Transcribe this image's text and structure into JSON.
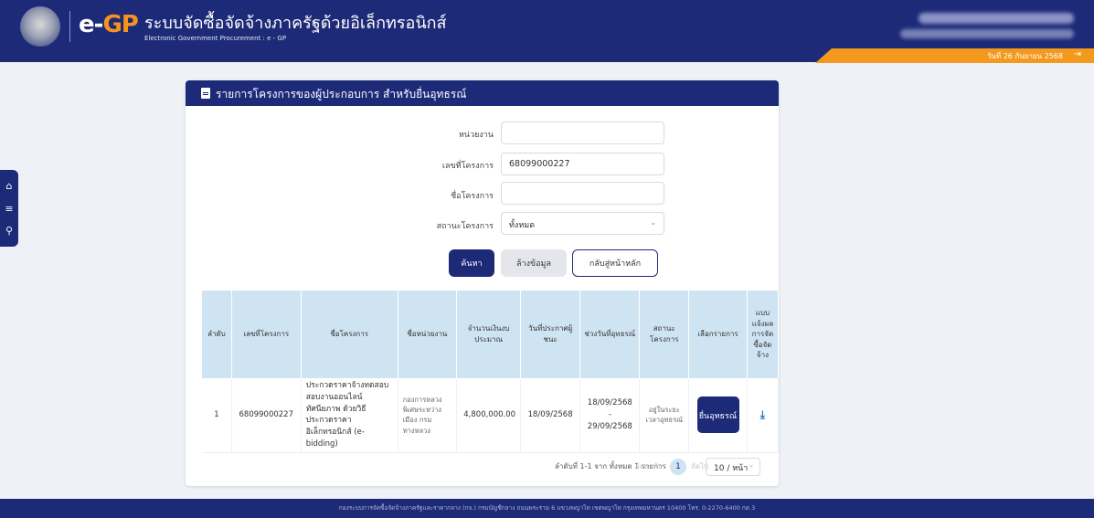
{
  "header": {
    "logo_e": "e-",
    "logo_gp": "GP",
    "title_th": "ระบบจัดซื้อจัดจ้างภาครัฐด้วยอิเล็กทรอนิกส์",
    "title_en": "Electronic Government Procurement : e - GP",
    "date_text": "วันที่ 26 กันยายน 2568"
  },
  "sidenav": {
    "icons": [
      "home-icon",
      "menu-icon",
      "search-icon"
    ]
  },
  "card": {
    "title": "รายการโครงการของผู้ประกอบการ สำหรับยื่นอุทธรณ์"
  },
  "form": {
    "agency_label": "หน่วยงาน",
    "agency_value": "",
    "project_no_label": "เลขที่โครงการ",
    "project_no_value": "68099000227",
    "project_name_label": "ชื่อโครงการ",
    "project_name_value": "",
    "status_label": "สถานะโครงการ",
    "status_value": "ทั้งหมด"
  },
  "buttons": {
    "search": "ค้นหา",
    "clear": "ล้างข้อมูล",
    "home": "กลับสู่หน้าหลัก"
  },
  "table": {
    "headers": {
      "no": "ลำดับ",
      "project_no": "เลขที่โครงการ",
      "project_name": "ชื่อโครงการ",
      "agency": "ชื่อหน่วยงาน",
      "budget": "จำนวนเงินงบประมาณ",
      "announce_date": "วันที่ประกาศผู้ชนะ",
      "appeal_period": "ช่วงวันที่อุทธรณ์",
      "status": "สถานะโครงการ",
      "select": "เลือกรายการ",
      "form": "แบบแจ้งผลการจัดซื้อจัดจ้าง"
    },
    "rows": [
      {
        "no": "1",
        "project_no": "68099000227",
        "project_name": "ประกวดราคาจ้างทดสอบสอบงานออนไลน์ ทัศนียภาพ ด้วยวิธีประกวดราคาอิเล็กทรอนิกส์ (e-bidding)",
        "agency": "กองการหลวงพิเศษระหว่างเมือง กรมทางหลวง",
        "budget": "4,800,000.00",
        "announce_date": "18/09/2568",
        "appeal_from": "18/09/2568",
        "appeal_sep": "-",
        "appeal_to": "29/09/2568",
        "status": "อยู่ในระยะเวลาอุทธรณ์",
        "action_label": "ยื่นอุทธรณ์",
        "download_icon": "download-icon"
      }
    ]
  },
  "pagination": {
    "summary": "ลำดับที่ 1-1 จาก ทั้งหมด 1 รายการ",
    "prev": "ย้อนกลับ",
    "current": "1",
    "next": "ถัดไป",
    "page_size": "10 / หน้า"
  },
  "footer": {
    "text": "กองระบบการจัดซื้อจัดจ้างภาครัฐและราคากลาง (กจ.) กรมบัญชีกลาง ถนนพระราม 6 แขวงพญาไท เขตพญาไท กรุงเทพมหานคร 10400 โทร. 0-2270-6400 กด 3"
  },
  "colors": {
    "primary": "#1d2a78",
    "accent": "#f39a1e",
    "table_head": "#cfe4f3",
    "background": "#eef1f5"
  }
}
